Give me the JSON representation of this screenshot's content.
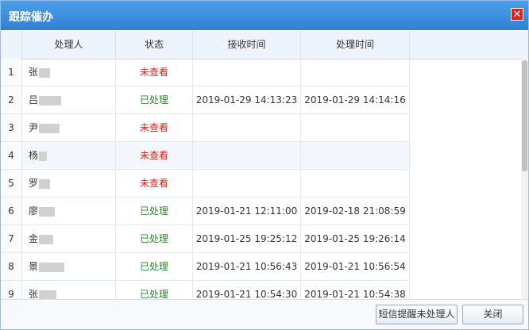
{
  "dialog": {
    "title": "跟踪催办"
  },
  "columns": {
    "handler": "处理人",
    "status": "状态",
    "received": "接收时间",
    "processed": "处理时间"
  },
  "rows": [
    {
      "num": "1",
      "name": "张",
      "status": "未查看",
      "received": "",
      "processed": ""
    },
    {
      "num": "2",
      "name": "吕",
      "status": "已处理",
      "received": "2019-01-29 14:13:23",
      "processed": "2019-01-29 14:14:16"
    },
    {
      "num": "3",
      "name": "尹",
      "status": "未查看",
      "received": "",
      "processed": ""
    },
    {
      "num": "4",
      "name": "杨",
      "status": "未查看",
      "received": "",
      "processed": ""
    },
    {
      "num": "5",
      "name": "罗",
      "status": "未查看",
      "received": "",
      "processed": ""
    },
    {
      "num": "6",
      "name": "廖",
      "status": "已处理",
      "received": "2019-01-21 12:11:00",
      "processed": "2019-02-18 21:08:59"
    },
    {
      "num": "7",
      "name": "金",
      "status": "已处理",
      "received": "2019-01-25 19:25:12",
      "processed": "2019-01-25 19:26:14"
    },
    {
      "num": "8",
      "name": "景",
      "status": "已处理",
      "received": "2019-01-21 10:56:43",
      "processed": "2019-01-21 10:56:54"
    },
    {
      "num": "9",
      "name": "张",
      "status": "已处理",
      "received": "2019-01-21 10:54:30",
      "processed": "2019-01-21 10:54:38"
    }
  ],
  "footer": {
    "sms_label": "短信提醒未处理人",
    "close_label": "关闭"
  },
  "colors": {
    "unread": "#e0201d",
    "done": "#2a8a2a",
    "titlebar": "#3a8fdd"
  },
  "icons": {
    "close": "close-icon"
  }
}
